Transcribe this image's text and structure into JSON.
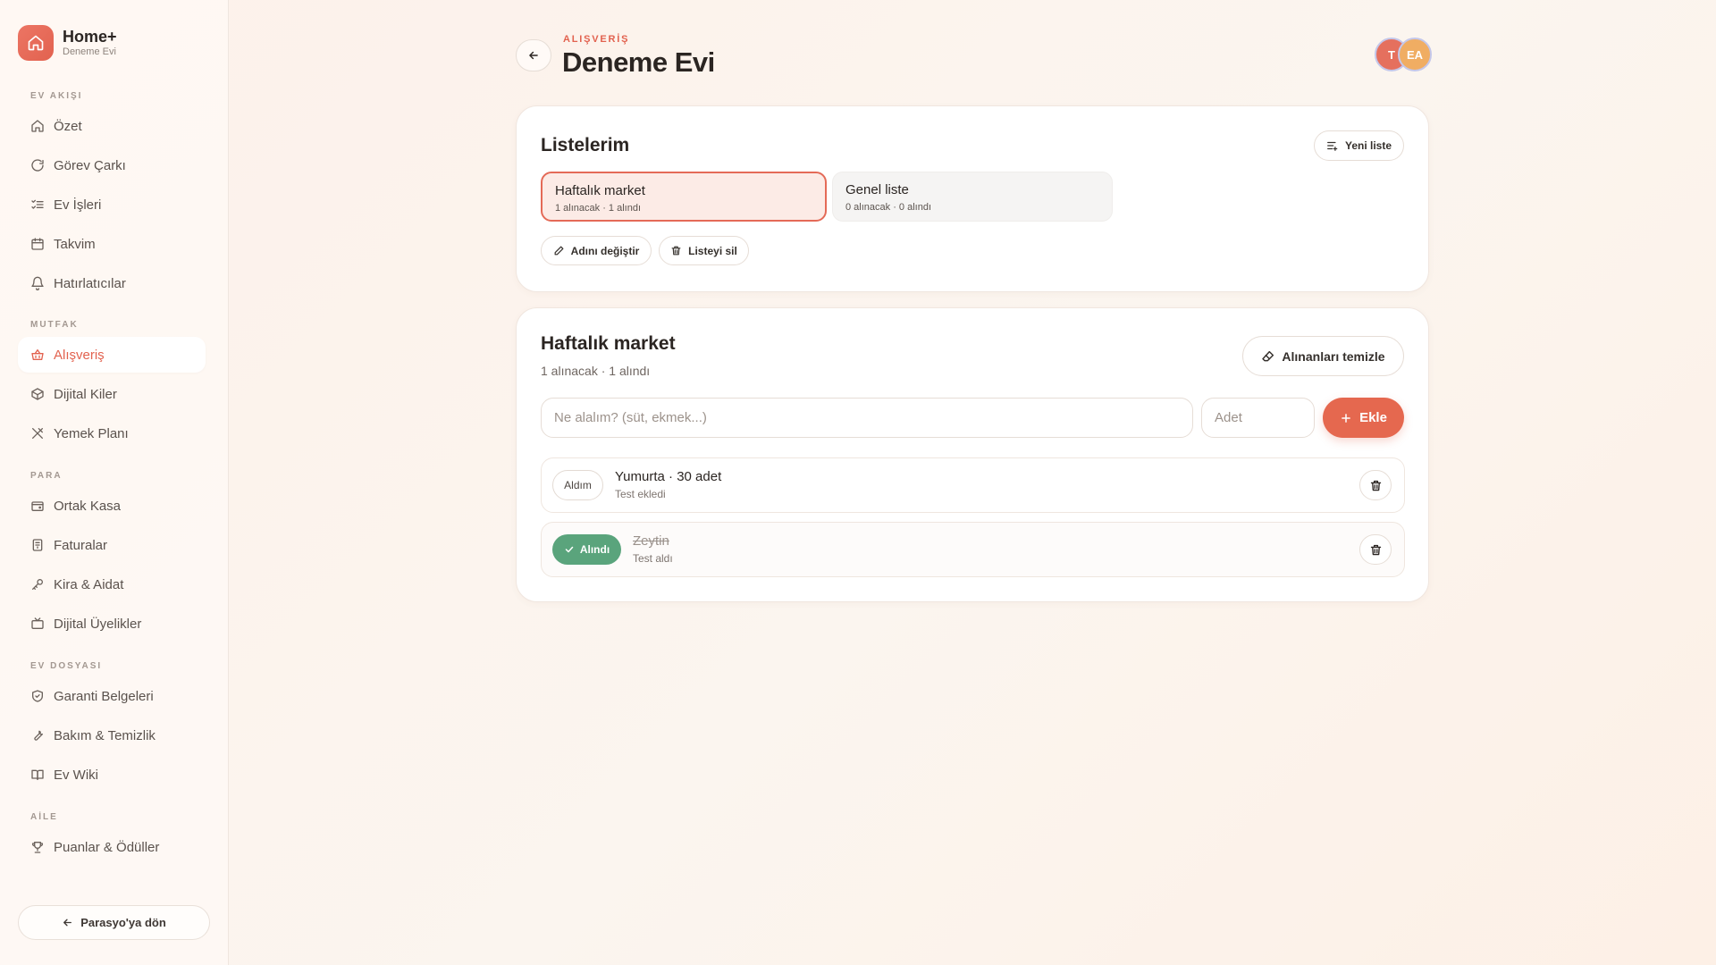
{
  "brand": {
    "name": "Home+",
    "subtitle": "Deneme Evi"
  },
  "sidebar": {
    "sections": [
      {
        "title": "EV AKIŞI",
        "items": [
          {
            "label": "Özet",
            "icon": "home-icon"
          },
          {
            "label": "Görev Çarkı",
            "icon": "refresh-icon"
          },
          {
            "label": "Ev İşleri",
            "icon": "checklist-icon"
          },
          {
            "label": "Takvim",
            "icon": "calendar-icon"
          },
          {
            "label": "Hatırlatıcılar",
            "icon": "bell-icon"
          }
        ]
      },
      {
        "title": "MUTFAK",
        "items": [
          {
            "label": "Alışveriş",
            "icon": "basket-icon",
            "active": true
          },
          {
            "label": "Dijital Kiler",
            "icon": "box-icon"
          },
          {
            "label": "Yemek Planı",
            "icon": "utensils-icon"
          }
        ]
      },
      {
        "title": "PARA",
        "items": [
          {
            "label": "Ortak Kasa",
            "icon": "wallet-icon"
          },
          {
            "label": "Faturalar",
            "icon": "receipt-icon"
          },
          {
            "label": "Kira & Aidat",
            "icon": "key-icon"
          },
          {
            "label": "Dijital Üyelikler",
            "icon": "tv-icon"
          }
        ]
      },
      {
        "title": "EV DOSYASI",
        "items": [
          {
            "label": "Garanti Belgeleri",
            "icon": "shield-icon"
          },
          {
            "label": "Bakım & Temizlik",
            "icon": "wrench-icon"
          },
          {
            "label": "Ev Wiki",
            "icon": "book-icon"
          }
        ]
      },
      {
        "title": "AİLE",
        "items": [
          {
            "label": "Puanlar & Ödüller",
            "icon": "trophy-icon"
          }
        ]
      }
    ],
    "back_label": "Parasyo'ya dön"
  },
  "header": {
    "eyebrow": "ALIŞVERİŞ",
    "title": "Deneme Evi",
    "avatars": [
      {
        "initials": "T",
        "color": "#e5705e"
      },
      {
        "initials": "EA",
        "color": "#f0ad63"
      }
    ]
  },
  "lists_card": {
    "title": "Listelerim",
    "new_list_label": "Yeni liste",
    "lists": [
      {
        "name": "Haftalık market",
        "meta": "1 alınacak · 1 alındı",
        "selected": true
      },
      {
        "name": "Genel liste",
        "meta": "0 alınacak · 0 alındı",
        "selected": false
      }
    ],
    "rename_label": "Adını değiştir",
    "delete_label": "Listeyi sil"
  },
  "list_detail": {
    "title": "Haftalık market",
    "summary": "1 alınacak · 1 alındı",
    "clear_label": "Alınanları temizle",
    "item_placeholder": "Ne alalım? (süt, ekmek...)",
    "qty_placeholder": "Adet",
    "add_label": "Ekle",
    "items": [
      {
        "name": "Yumurta · 30 adet",
        "sub": "Test ekledi",
        "toggle": "Aldım",
        "done": false
      },
      {
        "name": "Zeytin",
        "sub": "Test aldı",
        "toggle": "Alındı",
        "done": true
      }
    ]
  },
  "colors": {
    "accent": "#e2624f",
    "success": "#5aa47c"
  }
}
